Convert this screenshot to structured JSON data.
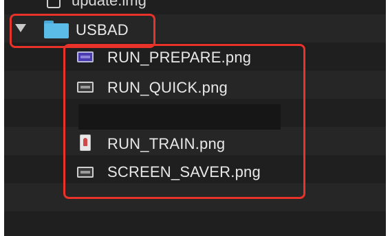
{
  "file_browser": {
    "partial_item": {
      "name": "update.img",
      "icon": "file-icon"
    },
    "folder": {
      "name": "USBAD",
      "expanded": true,
      "icon": "folder-icon",
      "color": "#5cbce8"
    },
    "files": [
      {
        "name": "RUN_PREPARE.png",
        "icon": "image-file-icon"
      },
      {
        "name": "RUN_QUICK.png",
        "icon": "image-file-icon"
      },
      {
        "name": "",
        "icon": "redacted-block"
      },
      {
        "name": "RUN_TRAIN.png",
        "icon": "image-file-icon"
      },
      {
        "name": "SCREEN_SAVER.png",
        "icon": "image-file-icon"
      }
    ],
    "highlight_color": "#e8322a",
    "background_color": "#1f1f1f"
  }
}
